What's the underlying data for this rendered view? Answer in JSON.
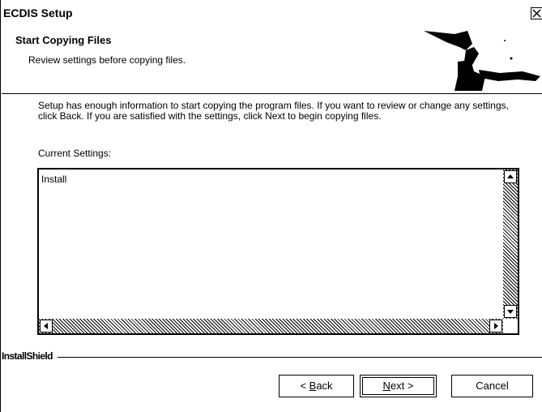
{
  "window": {
    "title": "ECDIS Setup",
    "close_icon": "close-icon"
  },
  "header": {
    "title": "Start Copying Files",
    "subtitle": "Review settings before copying files.",
    "graphic_icon": "installshield-setup-graphic"
  },
  "body": {
    "description": "Setup has enough information to start copying the program files.  If you want to review or change any settings, click Back.  If you are satisfied with the settings, click Next to begin copying files.",
    "settings_label": "Current Settings:",
    "settings_text": "Install"
  },
  "footer": {
    "brand": "InstallShield"
  },
  "buttons": {
    "back_prefix": "< ",
    "back_key": "B",
    "back_rest": "ack",
    "next_key": "N",
    "next_rest": "ext >",
    "cancel": "Cancel"
  }
}
